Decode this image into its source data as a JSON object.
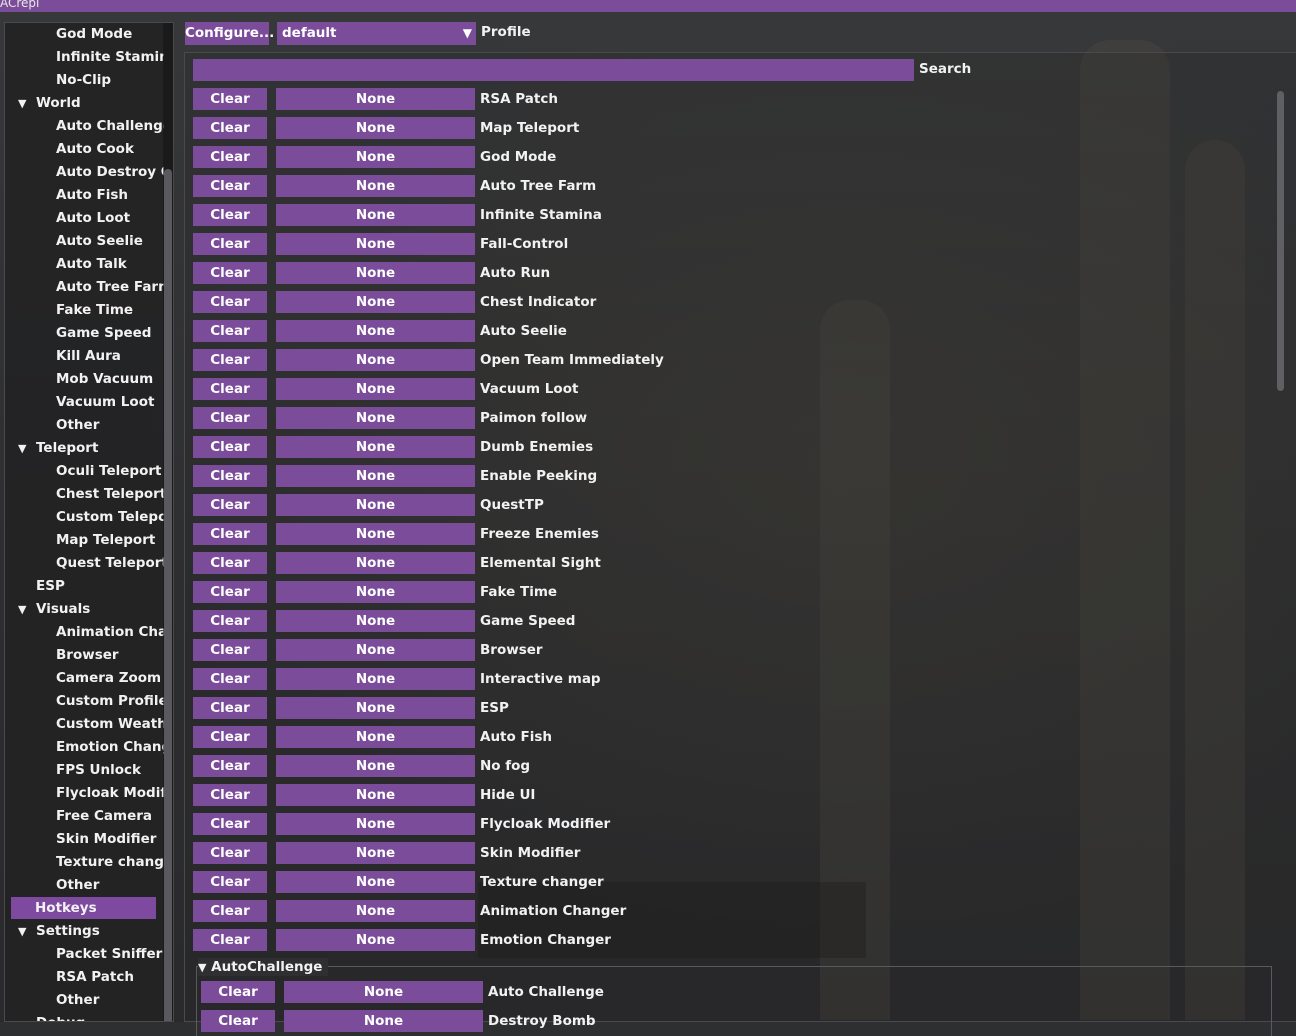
{
  "window": {
    "title": "ACrepi"
  },
  "toolbar": {
    "configure_label": "Configure...",
    "profile_value": "default",
    "profile_label": "Profile"
  },
  "search": {
    "label": "Search",
    "value": ""
  },
  "sidebar": {
    "items": [
      {
        "label": "God Mode",
        "level": "child"
      },
      {
        "label": "Infinite Stamina",
        "level": "child"
      },
      {
        "label": "No-Clip",
        "level": "child"
      },
      {
        "label": "World",
        "level": "parent",
        "expanded": true
      },
      {
        "label": "Auto Challenge",
        "level": "child"
      },
      {
        "label": "Auto Cook",
        "level": "child"
      },
      {
        "label": "Auto Destroy Ob",
        "level": "child"
      },
      {
        "label": "Auto Fish",
        "level": "child"
      },
      {
        "label": "Auto Loot",
        "level": "child"
      },
      {
        "label": "Auto Seelie",
        "level": "child"
      },
      {
        "label": "Auto Talk",
        "level": "child"
      },
      {
        "label": "Auto Tree Farm",
        "level": "child"
      },
      {
        "label": "Fake Time",
        "level": "child"
      },
      {
        "label": "Game Speed",
        "level": "child"
      },
      {
        "label": "Kill Aura",
        "level": "child"
      },
      {
        "label": "Mob Vacuum",
        "level": "child"
      },
      {
        "label": "Vacuum Loot",
        "level": "child"
      },
      {
        "label": "Other",
        "level": "child"
      },
      {
        "label": "Teleport",
        "level": "parent",
        "expanded": true
      },
      {
        "label": "Oculi Teleport",
        "level": "child"
      },
      {
        "label": "Chest Teleport",
        "level": "child"
      },
      {
        "label": "Custom Telepor",
        "level": "child"
      },
      {
        "label": "Map Teleport",
        "level": "child"
      },
      {
        "label": "Quest Teleport",
        "level": "child"
      },
      {
        "label": "ESP",
        "level": "parent",
        "expanded": false
      },
      {
        "label": "Visuals",
        "level": "parent",
        "expanded": true
      },
      {
        "label": "Animation Chan",
        "level": "child"
      },
      {
        "label": "Browser",
        "level": "child"
      },
      {
        "label": "Camera Zoom",
        "level": "child"
      },
      {
        "label": "Custom Profile",
        "level": "child"
      },
      {
        "label": "Custom Weathe",
        "level": "child"
      },
      {
        "label": "Emotion Change",
        "level": "child"
      },
      {
        "label": "FPS Unlock",
        "level": "child"
      },
      {
        "label": "Flycloak Modifie",
        "level": "child"
      },
      {
        "label": "Free Camera",
        "level": "child"
      },
      {
        "label": "Skin Modifier",
        "level": "child"
      },
      {
        "label": "Texture change",
        "level": "child"
      },
      {
        "label": "Other",
        "level": "child"
      },
      {
        "label": "Hotkeys",
        "level": "selected"
      },
      {
        "label": "Settings",
        "level": "parent",
        "expanded": true
      },
      {
        "label": "Packet Sniffer",
        "level": "child"
      },
      {
        "label": "RSA Patch",
        "level": "child"
      },
      {
        "label": "Other",
        "level": "child"
      },
      {
        "label": "Debug",
        "level": "parent",
        "expanded": false
      }
    ]
  },
  "hotkeys": {
    "clear_label": "Clear",
    "none_label": "None",
    "rows": [
      "RSA Patch",
      "Map Teleport",
      "God Mode",
      "Auto Tree Farm",
      "Infinite Stamina",
      "Fall-Control",
      "Auto Run",
      "Chest Indicator",
      "Auto Seelie",
      "Open Team Immediately",
      "Vacuum Loot",
      "Paimon follow",
      "Dumb Enemies",
      "Enable Peeking",
      "QuestTP",
      "Freeze Enemies",
      "Elemental Sight",
      "Fake Time",
      "Game Speed",
      "Browser",
      "Interactive map",
      "ESP",
      "Auto Fish",
      "No fog",
      "Hide UI",
      "Flycloak Modifier",
      "Skin Modifier",
      "Texture changer",
      "Animation Changer",
      "Emotion Changer"
    ],
    "group": {
      "title": "AutoChallenge",
      "rows": [
        "Auto Challenge",
        "Destroy Bomb"
      ]
    }
  },
  "colors": {
    "accent": "#7b4c9a",
    "text": "#f2f2f2",
    "background": "#2e2f31"
  },
  "icons": {
    "dropdown": "triangle-down-icon",
    "tree_expanded": "triangle-down-icon"
  }
}
